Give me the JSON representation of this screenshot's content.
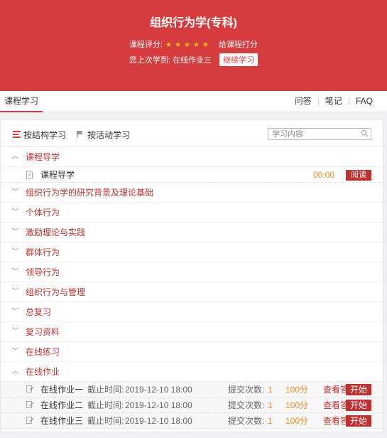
{
  "banner": {
    "title": "组织行为学(专科)",
    "rating_label": "课程评分:",
    "stars": "★★★★★",
    "rate_link": "给课程打分",
    "last_label": "您上次学到:",
    "last_item": "在线作业三",
    "continue_label": "继续学习"
  },
  "tabs": {
    "active": "课程学习",
    "right": [
      "问答",
      "笔记",
      "FAQ"
    ]
  },
  "toolbar": {
    "by_structure": "按结构学习",
    "by_activity": "按活动学习",
    "search_placeholder": "学习内容"
  },
  "chapters": [
    "课程导学",
    "组织行为学的研究背景及理论基础",
    "个体行为",
    "激励理论与实践",
    "群体行为",
    "领导行为",
    "组织行为与管理",
    "总复习",
    "复习资料",
    "在线练习",
    "在线作业"
  ],
  "intro_item": {
    "name": "课程导学",
    "time": "00:00",
    "read_label": "阅读"
  },
  "homework": [
    {
      "name": "在线作业一",
      "deadline_label": "截止时间:",
      "deadline": "2019-12-10 18:00",
      "submit_label": "提交次数:",
      "submit_count": "1",
      "score": "100分",
      "view_label": "查看答",
      "start_label": "开始"
    },
    {
      "name": "在线作业二",
      "deadline_label": "截止时间:",
      "deadline": "2019-12-10 18:00",
      "submit_label": "提交次数:",
      "submit_count": "1",
      "score": "100分",
      "view_label": "查看答",
      "start_label": "开始"
    },
    {
      "name": "在线作业三",
      "deadline_label": "截止时间:",
      "deadline": "2019-12-10 18:00",
      "submit_label": "提交次数:",
      "submit_count": "1",
      "score": "100分",
      "view_label": "查看答",
      "start_label": "开始"
    }
  ],
  "colors": {
    "accent": "#d63b3d",
    "label_red": "#c0302f",
    "orange": "#f08c1a"
  }
}
